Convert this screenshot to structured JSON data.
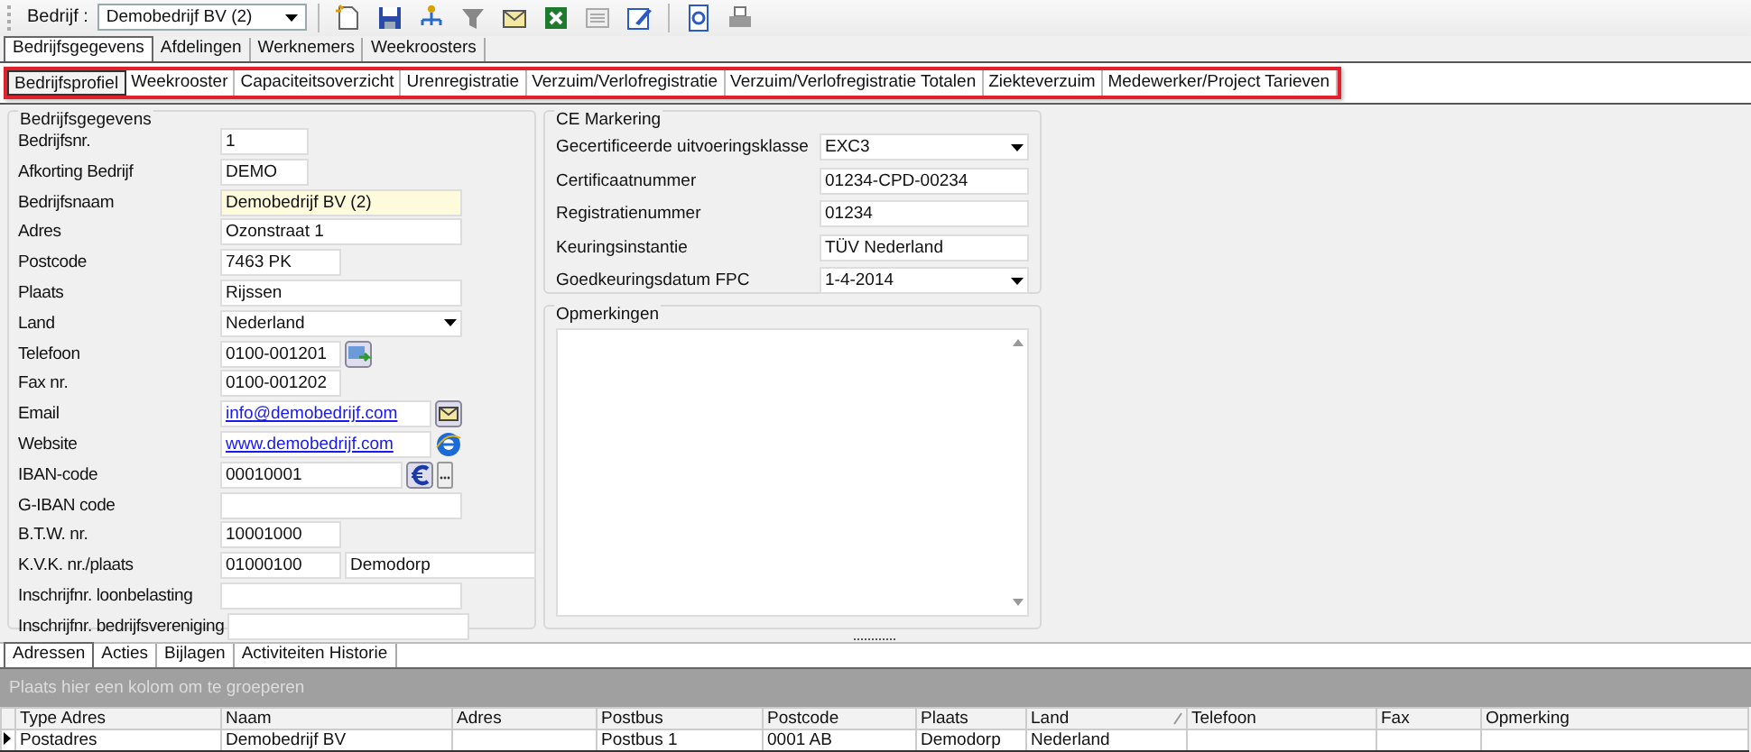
{
  "toolbar": {
    "company_label": "Bedrijf :",
    "company_value": "Demobedrijf BV (2)"
  },
  "tabs": [
    {
      "label": "Bedrijfsgegevens",
      "selected": true
    },
    {
      "label": "Afdelingen",
      "selected": false
    },
    {
      "label": "Werknemers",
      "selected": false
    },
    {
      "label": "Weekroosters",
      "selected": false
    }
  ],
  "subtabs": [
    {
      "label": "Bedrijfsprofiel",
      "selected": true
    },
    {
      "label": "Weekrooster",
      "selected": false
    },
    {
      "label": "Capaciteitsoverzicht",
      "selected": false
    },
    {
      "label": "Urenregistratie",
      "selected": false
    },
    {
      "label": "Verzuim/Verlofregistratie",
      "selected": false
    },
    {
      "label": "Verzuim/Verlofregistratie Totalen",
      "selected": false
    },
    {
      "label": "Ziekteverzuim",
      "selected": false
    },
    {
      "label": "Medewerker/Project Tarieven",
      "selected": false
    }
  ],
  "company_section": {
    "title": "Bedrijfsgegevens",
    "fields": [
      {
        "label": "Bedrijfsnr.",
        "value": "1",
        "kind": "text"
      },
      {
        "label": "Afkorting Bedrijf",
        "value": "DEMO",
        "kind": "text"
      },
      {
        "label": "Bedrijfsnaam",
        "value": "Demobedrijf BV (2)",
        "kind": "text",
        "highlighted": true
      },
      {
        "label": "Adres",
        "value": "Ozonstraat 1",
        "kind": "text"
      },
      {
        "label": "Postcode",
        "value": "7463 PK",
        "kind": "text"
      },
      {
        "label": "Plaats",
        "value": "Rijssen",
        "kind": "text"
      },
      {
        "label": "Land",
        "value": "Nederland",
        "kind": "select"
      },
      {
        "label": "Telefoon",
        "value": "0100-001201",
        "kind": "text",
        "buttons": [
          {
            "kind": "phone"
          }
        ]
      },
      {
        "label": "Fax nr.",
        "value": "0100-001202",
        "kind": "text"
      },
      {
        "label": "Email",
        "value": "info@demobedrijf.com",
        "kind": "link",
        "buttons": [
          {
            "kind": "mail"
          }
        ]
      },
      {
        "label": "Website",
        "value": "www.demobedrijf.com",
        "kind": "link",
        "buttons": [
          {
            "kind": "web"
          }
        ]
      },
      {
        "label": "IBAN-code",
        "value": "00010001",
        "kind": "text",
        "buttons": [
          {
            "kind": "euro"
          },
          {
            "kind": "more"
          }
        ]
      },
      {
        "label": "G-IBAN code",
        "kind": "text"
      },
      {
        "label": "B.T.W. nr.",
        "value": "10001000",
        "kind": "text"
      },
      {
        "label": "K.V.K. nr./plaats",
        "value": "01000100",
        "extra_value": "Demodorp",
        "kind": "text"
      },
      {
        "label": "Inschrijfnr. loonbelasting",
        "kind": "text"
      },
      {
        "label": "Inschrijfnr. bedrijfsvereniging",
        "kind": "text"
      }
    ]
  },
  "ce_section": {
    "title": "CE Markering",
    "fields": [
      {
        "label": "Gecertificeerde uitvoeringsklasse",
        "value": "EXC3",
        "kind": "select"
      },
      {
        "label": "Certificaatnummer",
        "value": "01234-CPD-00234",
        "kind": "text"
      },
      {
        "label": "Registratienummer",
        "value": "01234",
        "kind": "text"
      },
      {
        "label": "Keuringsinstantie",
        "value": "TÜV Nederland",
        "kind": "text"
      },
      {
        "label": "Goedkeuringsdatum FPC",
        "value": "1-4-2014",
        "kind": "select"
      }
    ]
  },
  "remarks": {
    "title": "Opmerkingen"
  },
  "bottom_tabs": [
    {
      "label": "Adressen",
      "selected": true
    },
    {
      "label": "Acties",
      "selected": false
    },
    {
      "label": "Bijlagen",
      "selected": false
    },
    {
      "label": "Activiteiten Historie",
      "selected": false
    }
  ],
  "grid": {
    "group_hint": "Plaats hier een kolom om te groeperen",
    "columns": [
      {
        "label": "Type Adres",
        "sorted": false
      },
      {
        "label": "Naam",
        "sorted": false
      },
      {
        "label": "Adres",
        "sorted": false
      },
      {
        "label": "Postbus",
        "sorted": false
      },
      {
        "label": "Postcode",
        "sorted": false
      },
      {
        "label": "Plaats",
        "sorted": false
      },
      {
        "label": "Land",
        "sorted": true
      },
      {
        "label": "Telefoon",
        "sorted": false
      },
      {
        "label": "Fax",
        "sorted": false
      },
      {
        "label": "Opmerking",
        "sorted": false
      }
    ],
    "rows": [
      {
        "current": true,
        "cells": [
          "Postadres",
          "Demobedrijf BV",
          "",
          "Postbus 1",
          "0001 AB",
          "Demodorp",
          "Nederland",
          "",
          "",
          ""
        ]
      }
    ]
  }
}
